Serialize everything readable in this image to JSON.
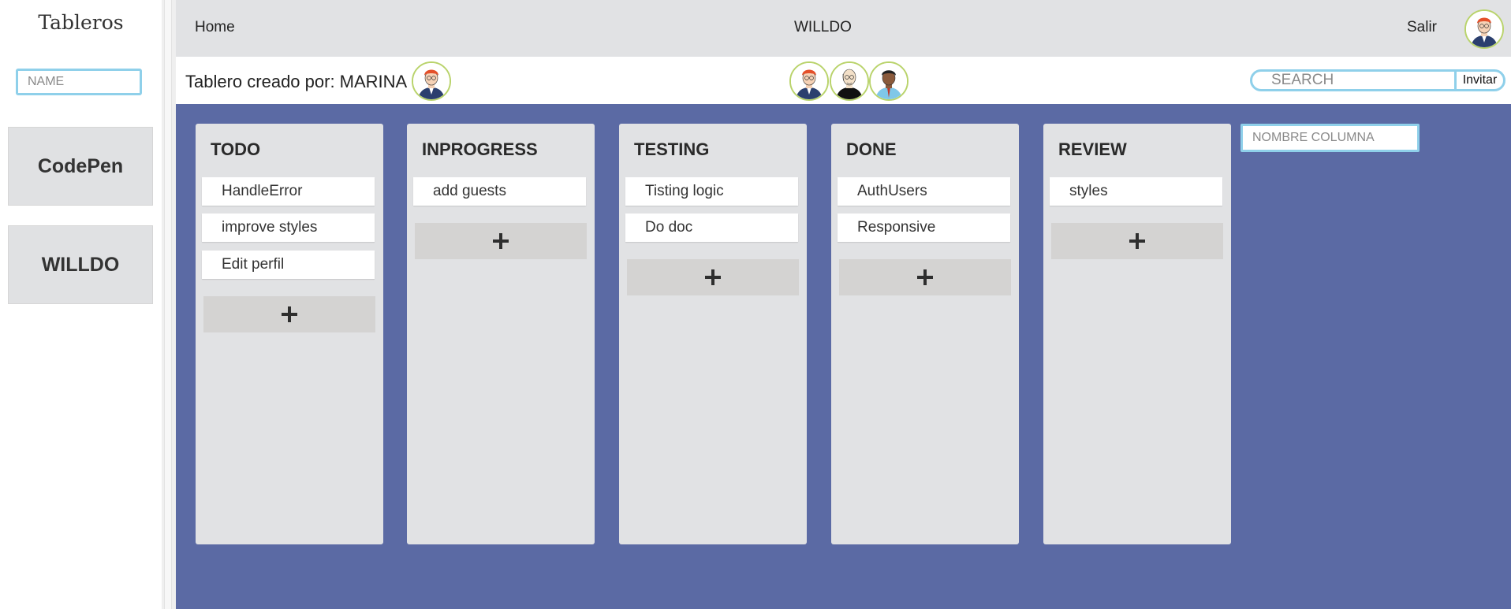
{
  "sidebar": {
    "title": "Tableros",
    "name_placeholder": "NAME",
    "boards": [
      "CodePen",
      "WILLDO"
    ]
  },
  "nav": {
    "home": "Home",
    "brand": "WILLDO",
    "exit": "Salir"
  },
  "board": {
    "owner_label": "Tablero creado por: MARINA",
    "search_placeholder": "SEARCH",
    "invite_label": "Invitar",
    "new_column_placeholder": "NOMBRE COLUMNA",
    "columns": [
      {
        "title": "TODO",
        "tasks": [
          "HandleError",
          "improve styles",
          "Edit perfil"
        ]
      },
      {
        "title": "INPROGRESS",
        "tasks": [
          "add guests"
        ]
      },
      {
        "title": "TESTING",
        "tasks": [
          "Tisting logic",
          "Do doc"
        ]
      },
      {
        "title": "DONE",
        "tasks": [
          "AuthUsers",
          "Responsive"
        ]
      },
      {
        "title": "REVIEW",
        "tasks": [
          "styles"
        ]
      }
    ]
  },
  "icons": {
    "add": "plus-icon",
    "avatar": "avatar-icon"
  },
  "colors": {
    "board_background": "#5b6aa4",
    "column_background": "#e1e2e4",
    "input_border": "#8fd0ea",
    "avatar_border": "#b9d36b"
  }
}
